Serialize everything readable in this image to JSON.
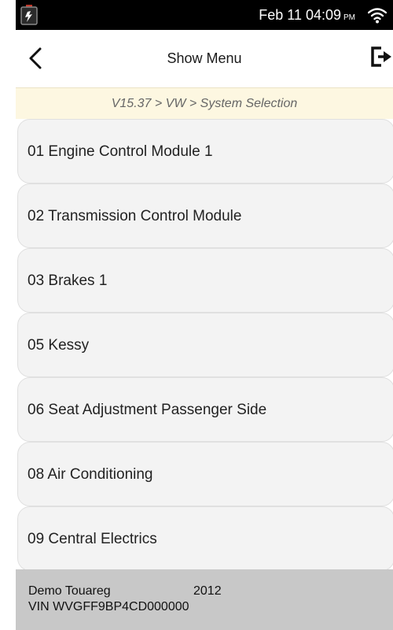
{
  "status_bar": {
    "date_time": "Feb 11 04:09",
    "ampm": "PM",
    "battery_icon": "battery-charging-icon",
    "wifi_icon": "wifi-icon"
  },
  "header": {
    "title": "Show Menu",
    "back_icon": "back-arrow-icon",
    "exit_icon": "exit-icon"
  },
  "breadcrumb": "V15.37 > VW > System Selection",
  "menu_items": [
    {
      "label": "01 Engine Control Module 1"
    },
    {
      "label": "02 Transmission Control Module"
    },
    {
      "label": "03 Brakes 1"
    },
    {
      "label": "05 Kessy"
    },
    {
      "label": "06 Seat Adjustment Passenger Side"
    },
    {
      "label": "08 Air Conditioning"
    },
    {
      "label": "09 Central Electrics"
    }
  ],
  "footer": {
    "model": "Demo Touareg",
    "year": "2012",
    "vin": "VIN WVGFF9BP4CD000000"
  },
  "colors": {
    "status_bar": "#000000",
    "breadcrumb_bg": "#fdf7e1",
    "item_bg": "#f3f3f3",
    "footer_bg": "#c8c8c8"
  }
}
